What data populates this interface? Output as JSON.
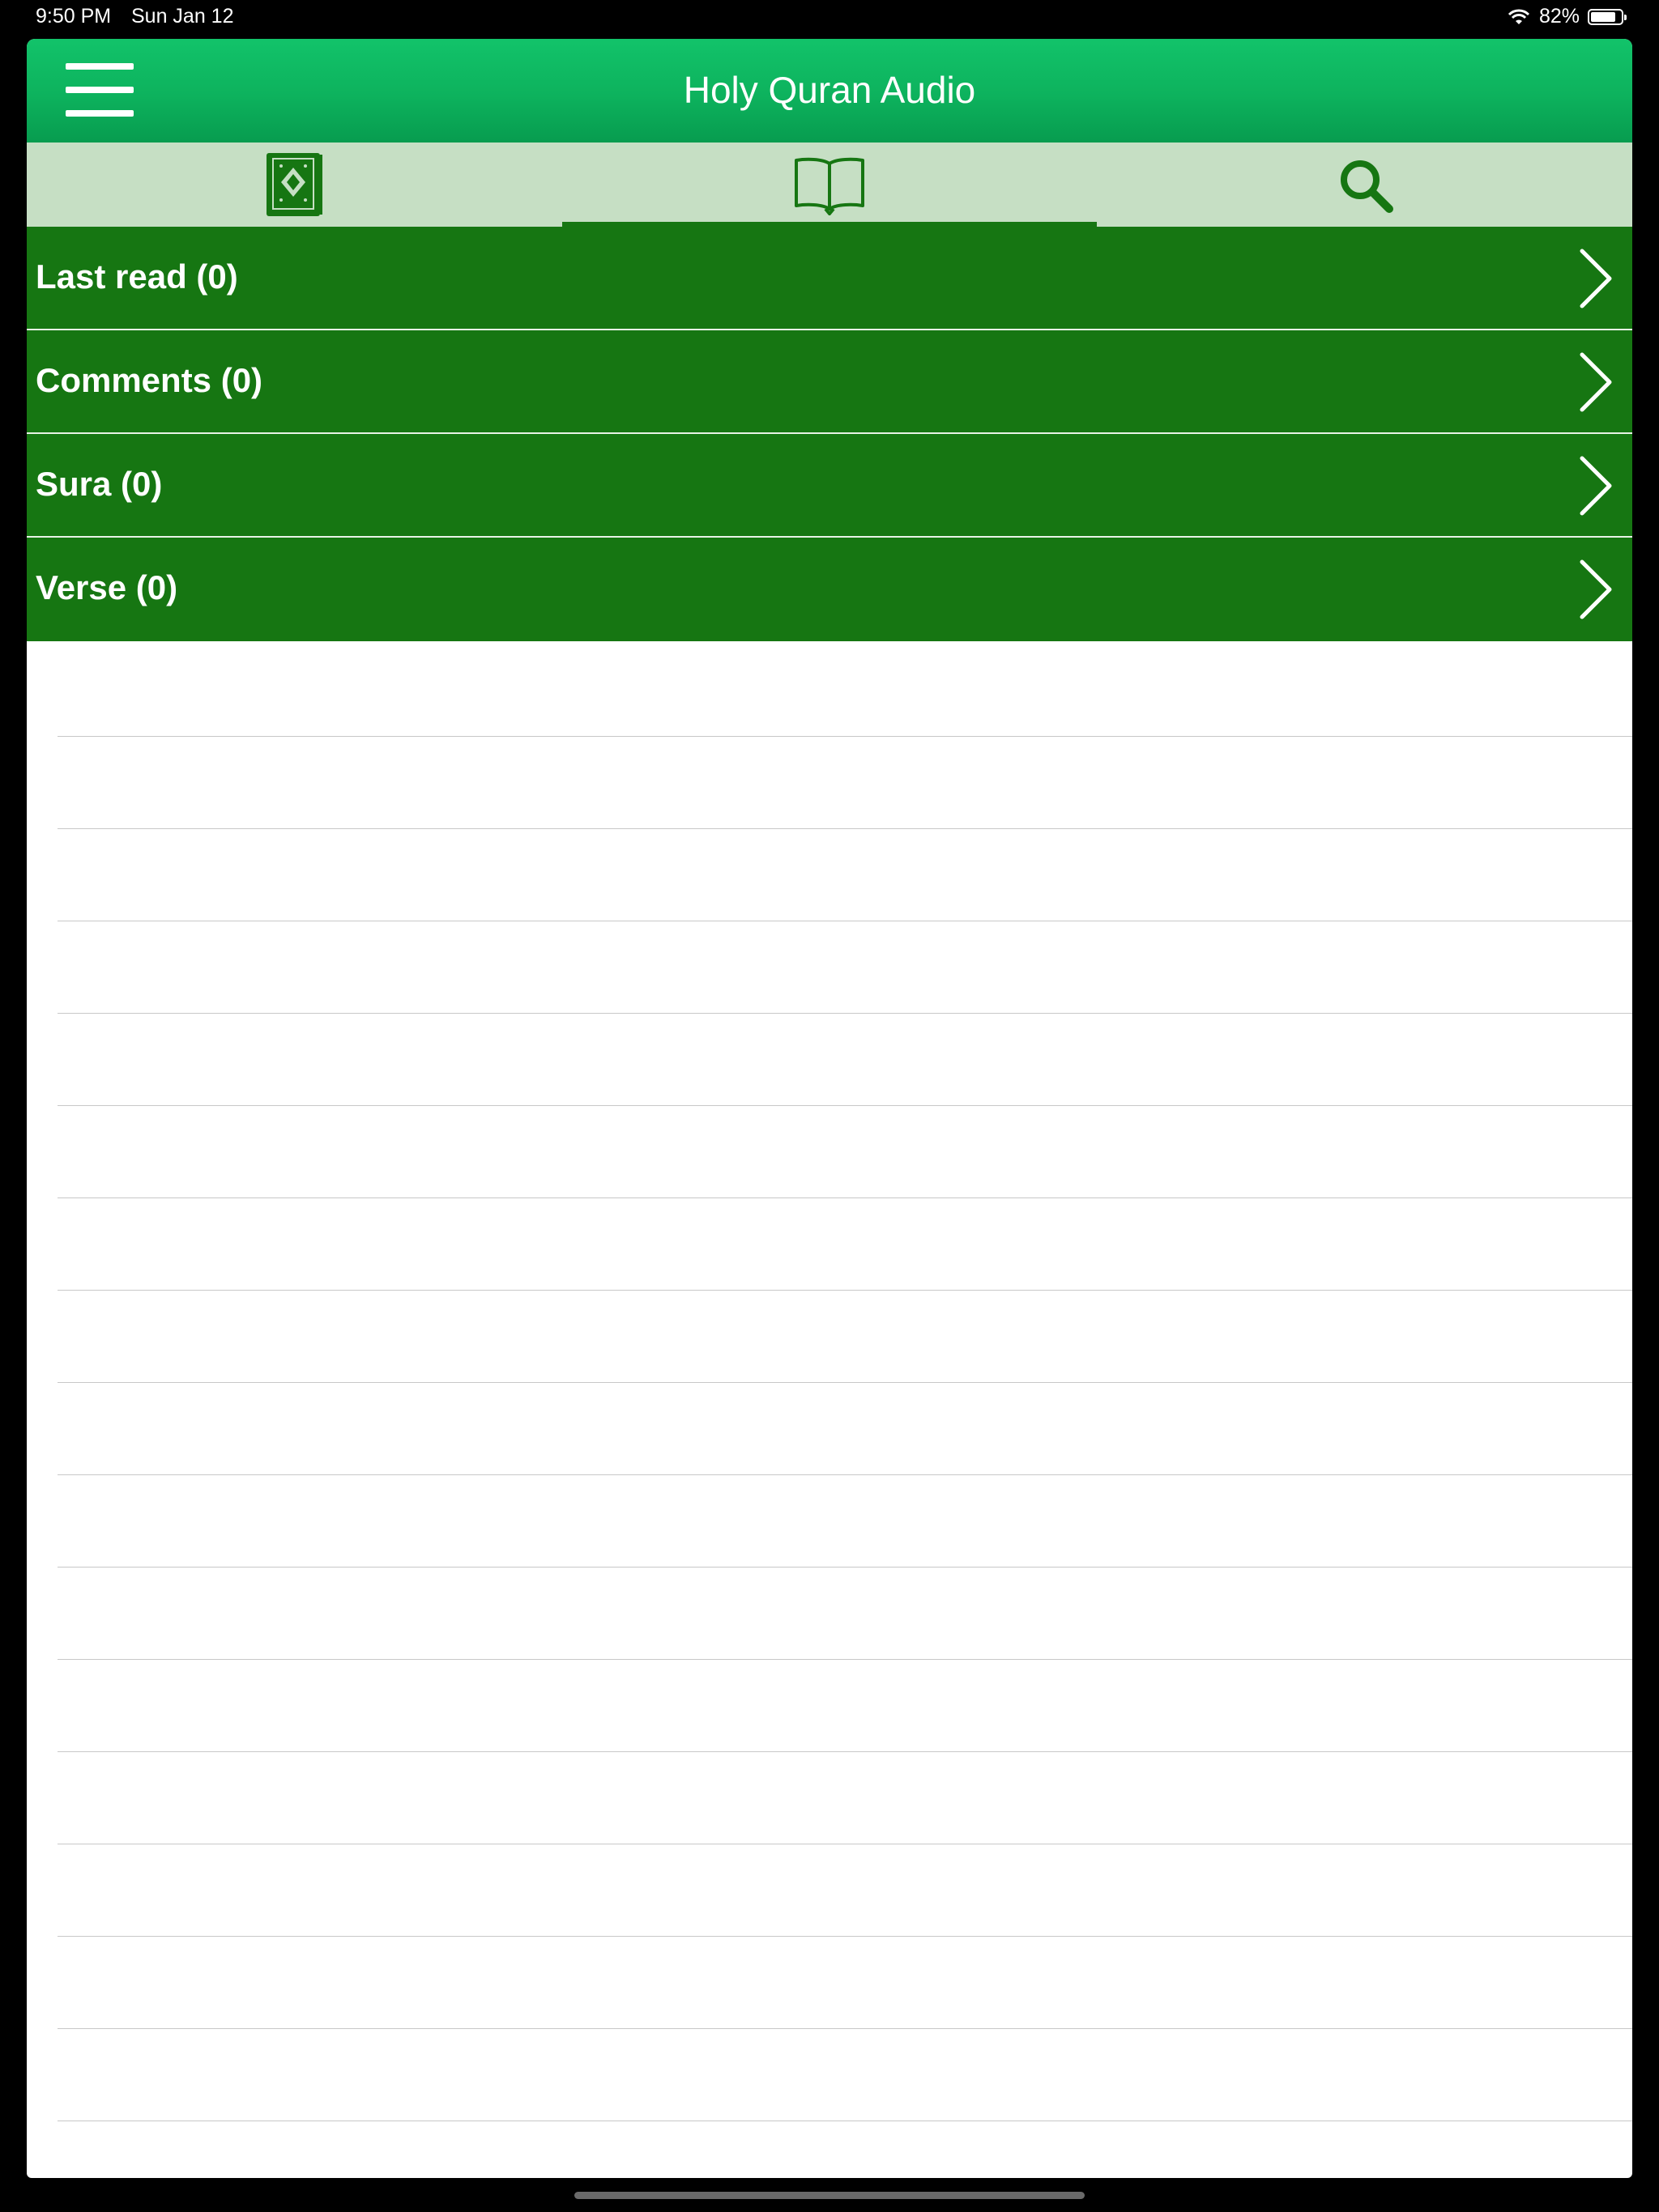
{
  "status_bar": {
    "time": "9:50 PM",
    "date": "Sun Jan 12",
    "battery": "82%",
    "battery_level": 0.82,
    "wifi_icon": "wifi-icon"
  },
  "nav": {
    "title": "Holy Quran Audio",
    "menu_icon": "hamburger-menu-icon"
  },
  "tabs": [
    {
      "icon": "quran-book-icon",
      "selected": false
    },
    {
      "icon": "open-book-icon",
      "selected": true
    },
    {
      "icon": "search-icon",
      "selected": false
    }
  ],
  "groups": [
    {
      "label": "Last read (0)"
    },
    {
      "label": "Comments (0)"
    },
    {
      "label": "Sura (0)"
    },
    {
      "label": "Verse (0)"
    }
  ],
  "colors": {
    "nav_green": "#0db25d",
    "row_green": "#167612",
    "tab_bar_bg": "#c6dfc4",
    "tab_icon": "#167612"
  }
}
